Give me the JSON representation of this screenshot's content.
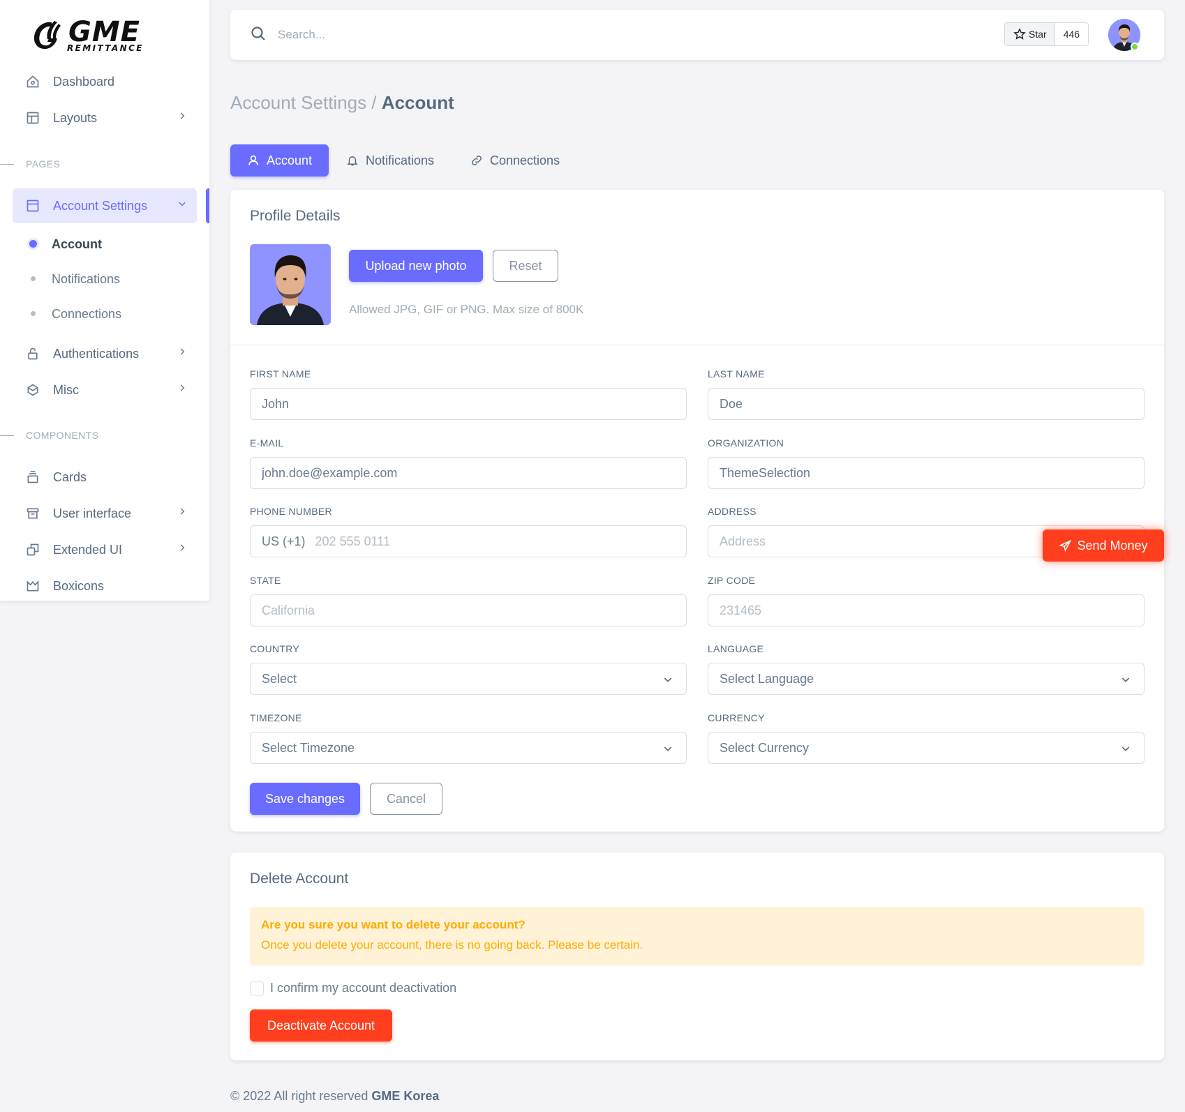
{
  "brand": {
    "name": "GME",
    "subtitle": "REMITTANCE"
  },
  "sidebar": {
    "items_top": [
      {
        "label": "Dashboard",
        "icon": "home-icon"
      },
      {
        "label": "Layouts",
        "icon": "layout-icon"
      }
    ],
    "section_pages": "PAGES",
    "account_settings": {
      "label": "Account Settings",
      "icon": "dock-icon"
    },
    "sub_items": [
      {
        "label": "Account",
        "active": true
      },
      {
        "label": "Notifications"
      },
      {
        "label": "Connections"
      }
    ],
    "items_pages": [
      {
        "label": "Authentications",
        "icon": "lock-icon"
      },
      {
        "label": "Misc",
        "icon": "cube-icon"
      }
    ],
    "section_components": "COMPONENTS",
    "items_components": [
      {
        "label": "Cards",
        "icon": "collection-icon"
      },
      {
        "label": "User interface",
        "icon": "box-icon"
      },
      {
        "label": "Extended UI",
        "icon": "copy-icon"
      },
      {
        "label": "Boxicons",
        "icon": "crown-icon"
      }
    ]
  },
  "topbar": {
    "search_placeholder": "Search...",
    "star_label": "Star",
    "star_count": "446"
  },
  "breadcrumb": {
    "parent": "Account Settings /",
    "current": "Account"
  },
  "tabs": [
    {
      "label": "Account",
      "icon": "user-icon",
      "active": true
    },
    {
      "label": "Notifications",
      "icon": "bell-icon"
    },
    {
      "label": "Connections",
      "icon": "link-icon"
    }
  ],
  "profile": {
    "title": "Profile Details",
    "upload_label": "Upload new photo",
    "reset_label": "Reset",
    "hint": "Allowed JPG, GIF or PNG. Max size of 800K"
  },
  "form": {
    "first_name": {
      "label": "First Name",
      "value": "John"
    },
    "last_name": {
      "label": "Last Name",
      "value": "Doe"
    },
    "email": {
      "label": "E-mail",
      "value": "john.doe@example.com"
    },
    "organization": {
      "label": "Organization",
      "value": "ThemeSelection"
    },
    "phone": {
      "label": "Phone Number",
      "prefix": "US (+1)",
      "placeholder": "202 555 0111"
    },
    "address": {
      "label": "Address",
      "placeholder": "Address"
    },
    "state": {
      "label": "State",
      "placeholder": "California"
    },
    "zip": {
      "label": "Zip Code",
      "placeholder": "231465"
    },
    "country": {
      "label": "Country",
      "selected": "Select"
    },
    "language": {
      "label": "Language",
      "selected": "Select Language"
    },
    "timezone": {
      "label": "Timezone",
      "selected": "Select Timezone"
    },
    "currency": {
      "label": "Currency",
      "selected": "Select Currency"
    },
    "save_label": "Save changes",
    "cancel_label": "Cancel"
  },
  "send_money": {
    "label": "Send Money"
  },
  "delete_account": {
    "title": "Delete Account",
    "alert_title": "Are you sure you want to delete your account?",
    "alert_text": "Once you delete your account, there is no going back. Please be certain.",
    "confirm_label": "I confirm my account deactivation",
    "button_label": "Deactivate Account"
  },
  "footer": {
    "text": "© 2022 All right reserved ",
    "brand": "GME Korea"
  },
  "colors": {
    "primary": "#696cff",
    "danger": "#ff3e1d",
    "warning": "#ffab00",
    "online": "#71dd37"
  }
}
